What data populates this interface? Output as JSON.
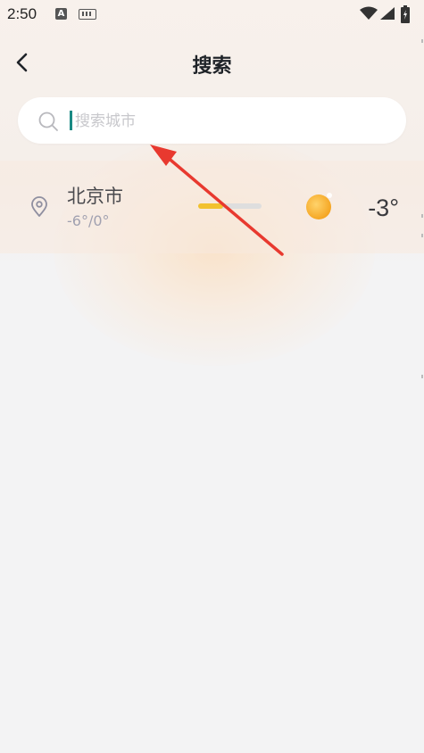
{
  "status_bar": {
    "time": "2:50",
    "notification_icon_letter": "A",
    "icons": [
      "keyboard-icon",
      "wifi-icon",
      "signal-icon",
      "battery-icon"
    ]
  },
  "header": {
    "title": "搜索",
    "back_icon": "chevron-left-icon"
  },
  "search": {
    "placeholder": "搜索城市",
    "value": "",
    "icon": "search-icon"
  },
  "results": [
    {
      "city": "北京市",
      "range": "-6°/0°",
      "current_temp": "-3°",
      "range_fill_fraction": 0.4,
      "weather_icon": "sun-icon"
    }
  ],
  "colors": {
    "accent": "#1a8a84",
    "range_fill": "#f2c12e",
    "arrow": "#e8392f",
    "sun": "#f5a623"
  }
}
